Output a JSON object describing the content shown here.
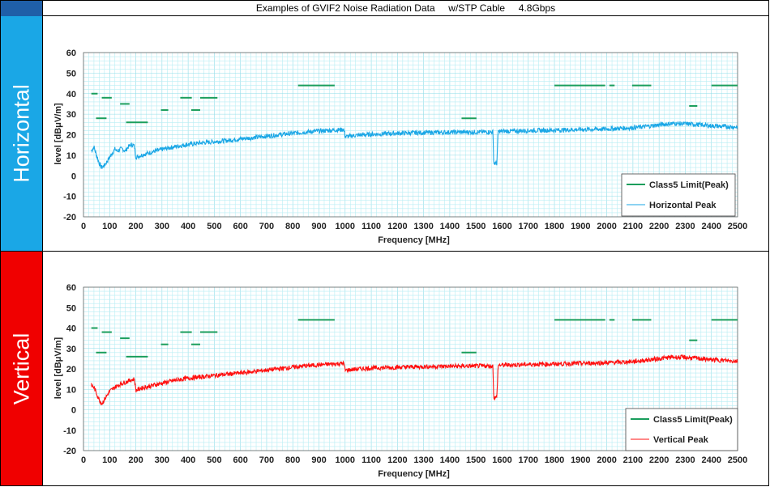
{
  "title": "Examples of GVIF2 Noise Radiation Data     w/STP Cable     4.8Gbps",
  "side_labels": {
    "horizontal": "Horizontal",
    "vertical": "Vertical"
  },
  "colors": {
    "corner": "#1f5fa8",
    "horizontal_band": "#1aa7e6",
    "vertical_band": "#f00000",
    "limit": "#1a9e5c",
    "horizontal_trace": "#1aa7e6",
    "vertical_trace": "#ff1010",
    "grid": "#b8eef4"
  },
  "chart_data": [
    {
      "type": "line",
      "panel": "horizontal",
      "xlabel": "Frequency [MHz]",
      "ylabel": "level [dBμV/m]",
      "xlim": [
        0,
        2500
      ],
      "ylim": [
        -20,
        60
      ],
      "xticks": [
        "0",
        "100",
        "200",
        "300",
        "400",
        "500",
        "600",
        "700",
        "800",
        "900",
        "1000",
        "1100",
        "1200",
        "1300",
        "1400",
        "1500",
        "1600",
        "1700",
        "1800",
        "1900",
        "2000",
        "2100",
        "2200",
        "2300",
        "2400",
        "2500"
      ],
      "yticks": [
        "60",
        "50",
        "40",
        "30",
        "20",
        "10",
        "0",
        "-10",
        "-20"
      ],
      "grid": "on",
      "legend_position": "bottom-right",
      "series": [
        {
          "name": "Class5 Limit(Peak)",
          "kind": "limit",
          "segments": [
            [
              30,
              54,
              40
            ],
            [
              48,
              88,
              28
            ],
            [
              70,
              108,
              38
            ],
            [
              140,
              176,
              35
            ],
            [
              163,
              246,
              26
            ],
            [
              296,
              324,
              32
            ],
            [
              370,
              414,
              38
            ],
            [
              412,
              446,
              32
            ],
            [
              446,
              512,
              38
            ],
            [
              820,
              960,
              44
            ],
            [
              1445,
              1502,
              28
            ],
            [
              1800,
              1994,
              44
            ],
            [
              2010,
              2030,
              44
            ],
            [
              2097,
              2170,
              44
            ],
            [
              2315,
              2346,
              34
            ],
            [
              2400,
              2500,
              44
            ]
          ]
        },
        {
          "name": "Horizontal Peak",
          "kind": "trace",
          "points": [
            [
              30,
              12
            ],
            [
              40,
              14
            ],
            [
              50,
              10
            ],
            [
              60,
              6
            ],
            [
              70,
              4
            ],
            [
              80,
              5
            ],
            [
              90,
              7
            ],
            [
              100,
              9
            ],
            [
              110,
              11
            ],
            [
              120,
              13
            ],
            [
              130,
              12
            ],
            [
              140,
              13
            ],
            [
              150,
              13
            ],
            [
              160,
              12
            ],
            [
              170,
              14
            ],
            [
              180,
              15
            ],
            [
              190,
              15
            ],
            [
              195,
              14
            ],
            [
              200,
              9
            ],
            [
              220,
              10
            ],
            [
              260,
              11.5
            ],
            [
              300,
              12.8
            ],
            [
              350,
              14.2
            ],
            [
              400,
              15.3
            ],
            [
              450,
              16
            ],
            [
              500,
              16.6
            ],
            [
              550,
              17.2
            ],
            [
              600,
              17.9
            ],
            [
              650,
              18.6
            ],
            [
              700,
              19.3
            ],
            [
              750,
              20
            ],
            [
              800,
              20.7
            ],
            [
              850,
              21.3
            ],
            [
              900,
              21.8
            ],
            [
              950,
              22.2
            ],
            [
              995,
              22.5
            ],
            [
              1000,
              19
            ],
            [
              1050,
              19.8
            ],
            [
              1100,
              20.2
            ],
            [
              1200,
              20.7
            ],
            [
              1300,
              21
            ],
            [
              1400,
              21.2
            ],
            [
              1500,
              21.3
            ],
            [
              1565,
              21.3
            ],
            [
              1568,
              6
            ],
            [
              1580,
              6
            ],
            [
              1585,
              21.6
            ],
            [
              1650,
              21.8
            ],
            [
              1700,
              22
            ],
            [
              1800,
              22.2
            ],
            [
              1900,
              22.5
            ],
            [
              2000,
              22.8
            ],
            [
              2100,
              23.4
            ],
            [
              2150,
              24
            ],
            [
              2200,
              24.8
            ],
            [
              2250,
              25.5
            ],
            [
              2300,
              25.3
            ],
            [
              2350,
              24.9
            ],
            [
              2400,
              24.3
            ],
            [
              2450,
              24
            ],
            [
              2500,
              23.7
            ]
          ]
        }
      ]
    },
    {
      "type": "line",
      "panel": "vertical",
      "xlabel": "Frequency [MHz]",
      "ylabel": "level [dBμV/m]",
      "xlim": [
        0,
        2500
      ],
      "ylim": [
        -20,
        60
      ],
      "xticks": [
        "0",
        "100",
        "200",
        "300",
        "400",
        "500",
        "600",
        "700",
        "800",
        "900",
        "1000",
        "1100",
        "1200",
        "1300",
        "1400",
        "1500",
        "1600",
        "1700",
        "1800",
        "1900",
        "2000",
        "2100",
        "2200",
        "2300",
        "2400",
        "2500"
      ],
      "yticks": [
        "60",
        "50",
        "40",
        "30",
        "20",
        "10",
        "0",
        "-10",
        "-20"
      ],
      "grid": "on",
      "legend_position": "bottom-right",
      "series": [
        {
          "name": "Class5 Limit(Peak)",
          "kind": "limit",
          "segments": [
            [
              30,
              54,
              40
            ],
            [
              48,
              88,
              28
            ],
            [
              70,
              108,
              38
            ],
            [
              140,
              176,
              35
            ],
            [
              163,
              246,
              26
            ],
            [
              296,
              324,
              32
            ],
            [
              370,
              414,
              38
            ],
            [
              412,
              446,
              32
            ],
            [
              446,
              512,
              38
            ],
            [
              820,
              960,
              44
            ],
            [
              1445,
              1502,
              28
            ],
            [
              1800,
              1994,
              44
            ],
            [
              2010,
              2030,
              44
            ],
            [
              2097,
              2170,
              44
            ],
            [
              2315,
              2346,
              34
            ],
            [
              2400,
              2500,
              44
            ]
          ]
        },
        {
          "name": "Vertical Peak",
          "kind": "trace",
          "points": [
            [
              30,
              12
            ],
            [
              40,
              11
            ],
            [
              50,
              8
            ],
            [
              60,
              5
            ],
            [
              70,
              3
            ],
            [
              80,
              5
            ],
            [
              90,
              7
            ],
            [
              100,
              9
            ],
            [
              120,
              11
            ],
            [
              140,
              12.5
            ],
            [
              160,
              13.5
            ],
            [
              180,
              14.5
            ],
            [
              195,
              15
            ],
            [
              200,
              9.5
            ],
            [
              220,
              10.5
            ],
            [
              260,
              11.8
            ],
            [
              300,
              13
            ],
            [
              350,
              14.4
            ],
            [
              400,
              15.4
            ],
            [
              450,
              16.1
            ],
            [
              500,
              16.8
            ],
            [
              550,
              17.4
            ],
            [
              600,
              18
            ],
            [
              650,
              18.7
            ],
            [
              700,
              19.4
            ],
            [
              750,
              20.1
            ],
            [
              800,
              20.8
            ],
            [
              850,
              21.5
            ],
            [
              900,
              22
            ],
            [
              950,
              22.4
            ],
            [
              995,
              22.7
            ],
            [
              1000,
              19.3
            ],
            [
              1050,
              20
            ],
            [
              1100,
              20.4
            ],
            [
              1200,
              20.8
            ],
            [
              1300,
              21.1
            ],
            [
              1400,
              21.3
            ],
            [
              1500,
              21.4
            ],
            [
              1565,
              21.4
            ],
            [
              1568,
              6
            ],
            [
              1580,
              6
            ],
            [
              1585,
              21.8
            ],
            [
              1650,
              22
            ],
            [
              1700,
              22.2
            ],
            [
              1800,
              22.4
            ],
            [
              1900,
              22.7
            ],
            [
              2000,
              23
            ],
            [
              2100,
              23.6
            ],
            [
              2150,
              24.3
            ],
            [
              2200,
              25
            ],
            [
              2250,
              25.8
            ],
            [
              2300,
              25.6
            ],
            [
              2350,
              25.1
            ],
            [
              2400,
              24.5
            ],
            [
              2450,
              24.1
            ],
            [
              2500,
              23.8
            ]
          ]
        }
      ]
    }
  ]
}
